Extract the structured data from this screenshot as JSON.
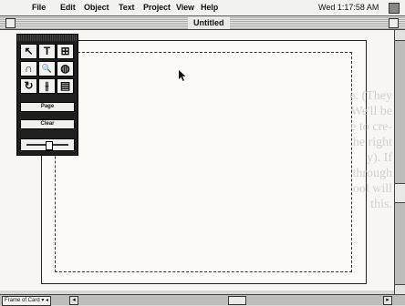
{
  "menubar": {
    "apple_icon": "apple-icon",
    "items": [
      "File",
      "Edit",
      "Object",
      "Text",
      "Project",
      "View",
      "Help"
    ],
    "clock": "Wed 1:17:58 AM"
  },
  "window": {
    "title": "Untitled"
  },
  "palette": {
    "tools": [
      {
        "name": "arrow-tool",
        "glyph": "↖"
      },
      {
        "name": "text-tool",
        "glyph": "T"
      },
      {
        "name": "field-tool",
        "glyph": "⊞"
      },
      {
        "name": "lasso-tool",
        "glyph": "∩"
      },
      {
        "name": "zoom-tool",
        "glyph": "🔍"
      },
      {
        "name": "fill-tool",
        "glyph": "◍"
      },
      {
        "name": "rotate-tool",
        "glyph": "↻"
      },
      {
        "name": "flip-tool",
        "glyph": "⫲"
      },
      {
        "name": "page-tool",
        "glyph": "▤"
      }
    ],
    "page_button": "Page",
    "clear_button": "Clear"
  },
  "ghost_text": {
    "lines": [
      "e. (They",
      "We'll be",
      "e to cre-",
      "he right",
      "y). If",
      "through",
      "ool will",
      "this."
    ]
  },
  "statusbar": {
    "zoom_field": "Frame of Card ▾ ◂"
  }
}
